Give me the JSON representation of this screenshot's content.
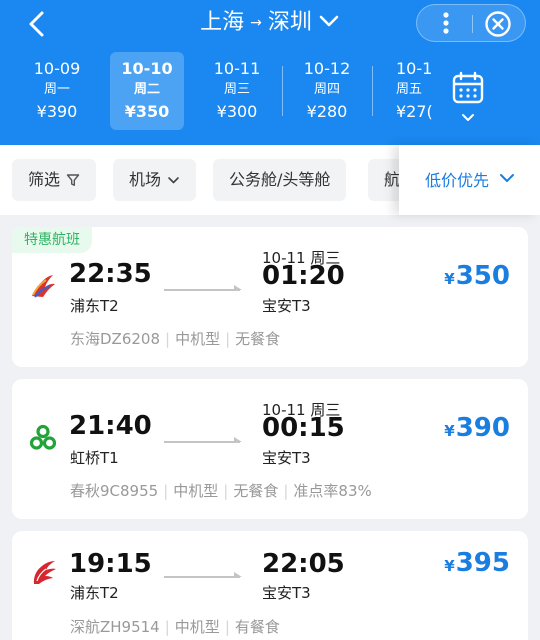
{
  "header": {
    "from_city": "上海",
    "arrow": "→",
    "to_city": "深圳"
  },
  "dates": [
    {
      "date": "10-09",
      "weekday": "周一",
      "price": "¥390",
      "selected": false
    },
    {
      "date": "10-10",
      "weekday": "周二",
      "price": "¥350",
      "selected": true
    },
    {
      "date": "10-11",
      "weekday": "周三",
      "price": "¥300",
      "selected": false
    },
    {
      "date": "10-12",
      "weekday": "周四",
      "price": "¥280",
      "selected": false
    },
    {
      "date": "10-1",
      "weekday": "周五",
      "price": "¥27(",
      "selected": false
    }
  ],
  "filters": {
    "filter": "筛选",
    "airport": "机场",
    "cabin": "公务舱/头等舱",
    "airline_partial": "航",
    "sort": "低价优先"
  },
  "flights": [
    {
      "promo": "特惠航班",
      "dep_time": "22:35",
      "dep_airport": "浦东T2",
      "arr_date": "10-11 周三",
      "arr_time": "01:20",
      "arr_airport": "宝安T3",
      "currency": "¥",
      "price": "350",
      "flight_no": "东海DZ6208",
      "aircraft": "中机型",
      "meal": "无餐食",
      "ontime": ""
    },
    {
      "promo": "",
      "dep_time": "21:40",
      "dep_airport": "虹桥T1",
      "arr_date": "10-11 周三",
      "arr_time": "00:15",
      "arr_airport": "宝安T3",
      "currency": "¥",
      "price": "390",
      "flight_no": "春秋9C8955",
      "aircraft": "中机型",
      "meal": "无餐食",
      "ontime": "准点率83%"
    },
    {
      "promo": "",
      "dep_time": "19:15",
      "dep_airport": "浦东T2",
      "arr_date": "",
      "arr_time": "22:05",
      "arr_airport": "宝安T3",
      "currency": "¥",
      "price": "395",
      "flight_no": "深航ZH9514",
      "aircraft": "中机型",
      "meal": "有餐食",
      "ontime": ""
    }
  ],
  "colors": {
    "header_bg": "#1a88f0",
    "accent": "#1a7de0",
    "promo_green": "#2cb560",
    "donghai_logo": "#d9342b",
    "spring_logo": "#22a33a",
    "shenzhen_logo": "#d6262f"
  }
}
